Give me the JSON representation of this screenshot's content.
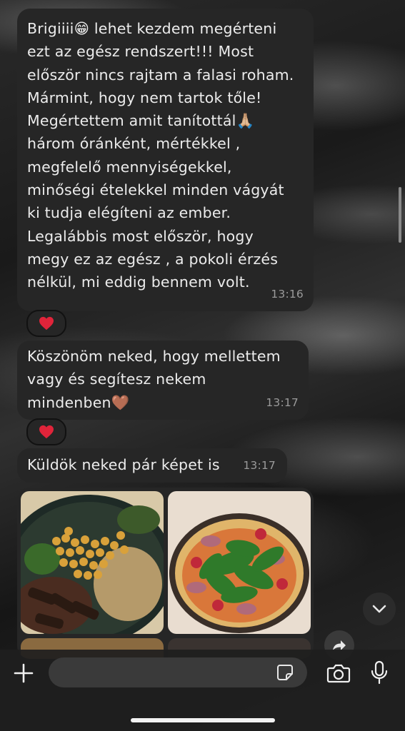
{
  "messages": [
    {
      "text": "Brigiiii😁 lehet kezdem megérteni\nezt az egész rendszert!!! Most\nelőször nincs rajtam a falasi roham.\nMármint, hogy nem tartok tőle!\nMegértettem amit tanítottál🙏🏼\nhárom óránként, mértékkel ,\nmegfelelő mennyiségekkel,\nminőségi ételekkel minden vágyát\nki tudja elégíteni az ember.\nLegalábbis most először, hogy\nmegy ez az egész , a pokoli érzés\nnélkül, mi eddig bennem volt.",
      "time": "13:16",
      "reaction": "❤️"
    },
    {
      "text": "Köszönöm neked, hogy mellettem\nvagy és segítesz nekem\nmindenben🤎",
      "time": "13:17",
      "reaction": "❤️"
    },
    {
      "text": "Küldök neked pár képet is",
      "time": "13:17"
    }
  ],
  "album": {
    "photos": [
      {
        "description_icon": "bowl-food-photo"
      },
      {
        "description_icon": "pizza-photo"
      }
    ]
  },
  "composer": {
    "placeholder": "",
    "icons": [
      "plus-icon",
      "sticker-icon",
      "camera-icon",
      "microphone-icon"
    ]
  },
  "colors": {
    "bubble": "#262626",
    "text": "#ececec",
    "timestamp": "#9a9a9a",
    "reaction_heart": "#e0243a"
  }
}
